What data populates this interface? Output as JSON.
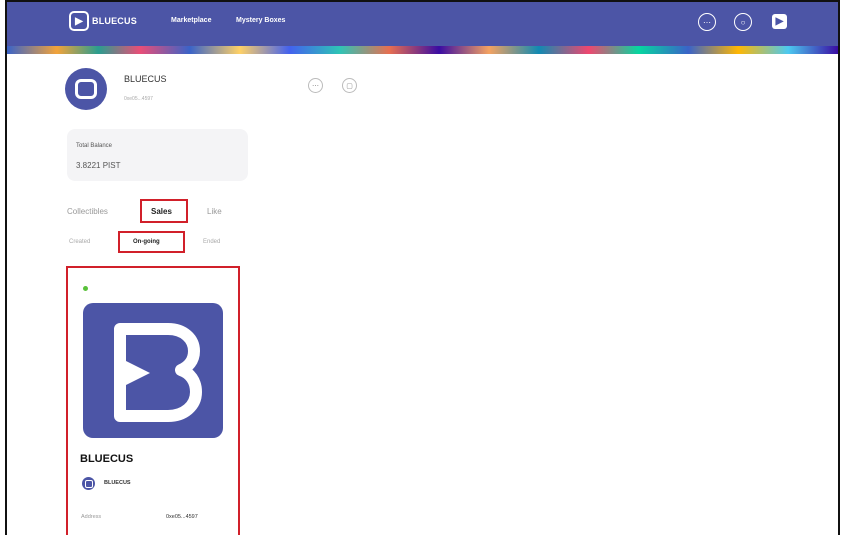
{
  "colors": {
    "brand": "#4c55a6",
    "highlight": "#d1202a",
    "status_online": "#59c13a"
  },
  "navbar": {
    "brand": "BLUECUS",
    "links": [
      "Marketplace",
      "Mystery Boxes"
    ],
    "icons": [
      "more-icon",
      "search-icon",
      "brand-icon"
    ]
  },
  "profile": {
    "name": "BLUECUS",
    "address": "0xe05...4597",
    "actions": [
      "more-icon",
      "share-icon"
    ]
  },
  "balance": {
    "label": "Total Balance",
    "value": "3.8221 PIST"
  },
  "tabs": [
    "Collectibles",
    "Sales",
    "Like"
  ],
  "active_tab": "Sales",
  "subtabs": [
    "Created",
    "On-going",
    "Ended"
  ],
  "active_subtab": "On-going",
  "nft": {
    "title": "BLUECUS",
    "creator": "BLUECUS",
    "address_label": "Address",
    "address_value": "0xe05...4597",
    "status": "online"
  }
}
